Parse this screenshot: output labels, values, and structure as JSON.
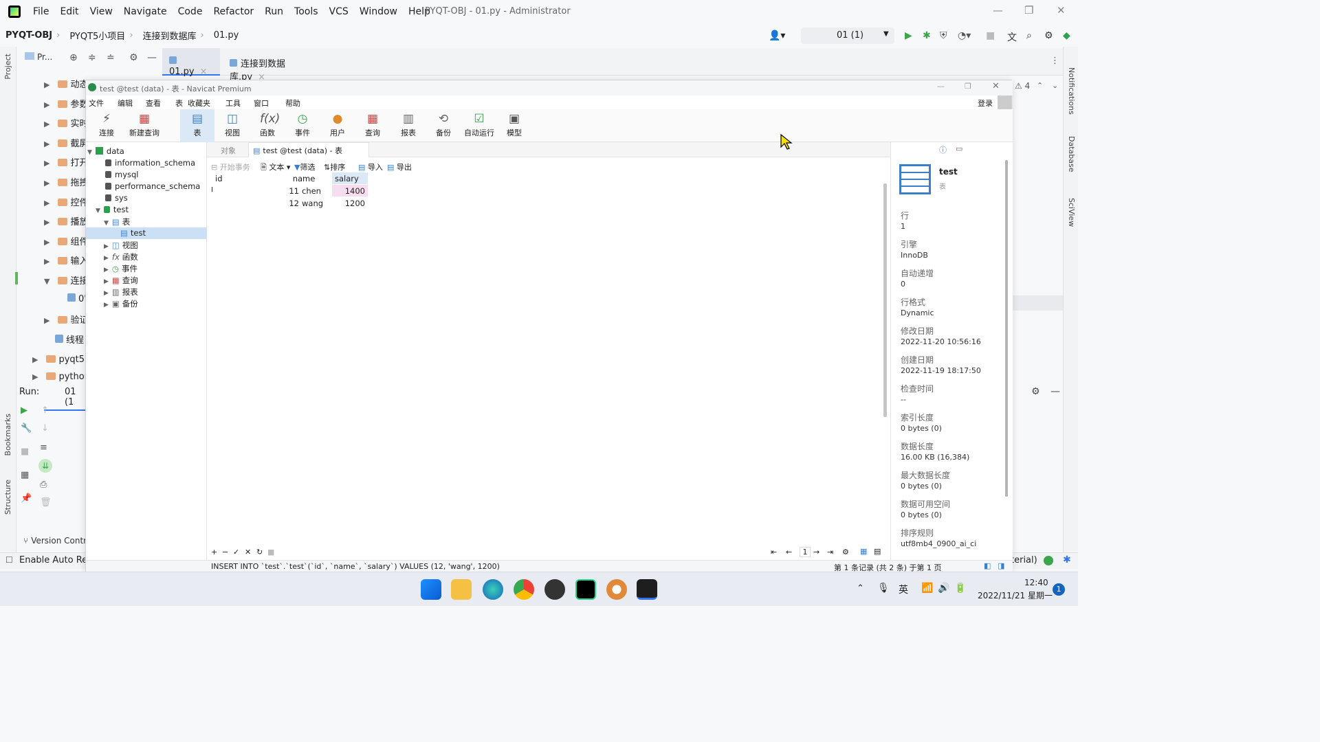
{
  "ide": {
    "menu": [
      "File",
      "Edit",
      "View",
      "Navigate",
      "Code",
      "Refactor",
      "Run",
      "Tools",
      "VCS",
      "Window",
      "Help"
    ],
    "window_title": "PYQT-OBJ - 01.py - Administrator",
    "breadcrumbs": [
      "PYQT-OBJ",
      "PYQT5小项目",
      "连接到数据库",
      "01.py"
    ],
    "run_config": "01 (1)",
    "project_label": "Pr...",
    "tabs": [
      {
        "label": "01.py"
      },
      {
        "label": "连接到数据库.py"
      }
    ],
    "warnings": "4",
    "project_items": [
      "动态",
      "参数(",
      "实时.",
      "截屏",
      "打开(",
      "拖拽!",
      "控件(",
      "播放.",
      "组件(",
      "输入(",
      "连接:",
      "0'",
      "验证(",
      "线程",
      "pyqt5的",
      "python"
    ],
    "run_label": "Run:",
    "run_tab": "01 (1",
    "side_labels": {
      "project": "Project",
      "bookmarks": "Bookmarks",
      "structure": "Structure",
      "notifications": "Notifications",
      "database": "Database",
      "sciview": "SciView"
    },
    "version_control": "Version Contro",
    "auto_rescan": "Enable Auto Res",
    "status_right": "terial)"
  },
  "navicat": {
    "title": "test @test (data) - 表 - Navicat Premium",
    "menu": [
      "文件",
      "编辑",
      "查看",
      "表",
      "收藏夹",
      "工具",
      "窗口",
      "帮助"
    ],
    "login": "登录",
    "toolbar": [
      "连接",
      "新建查询",
      "表",
      "视图",
      "函数",
      "事件",
      "用户",
      "查询",
      "报表",
      "备份",
      "自动运行",
      "模型"
    ],
    "tree": {
      "root": "data",
      "dbs": [
        "information_schema",
        "mysql",
        "performance_schema",
        "sys",
        "test"
      ],
      "group": "表",
      "table": "test",
      "others": [
        "视图",
        "函数",
        "事件",
        "查询",
        "报表",
        "备份"
      ]
    },
    "tabs": [
      "对象",
      "test @test (data) - 表"
    ],
    "subbar": [
      "开始事务",
      "文本",
      "筛选",
      "排序",
      "导入",
      "导出"
    ],
    "columns": [
      "id",
      "name",
      "salary"
    ],
    "rows": [
      {
        "id": "11",
        "name": "chen",
        "salary": "1400"
      },
      {
        "id": "12",
        "name": "wang",
        "salary": "1200"
      }
    ],
    "cursor_mark": "I",
    "page_number": "1",
    "sql": "INSERT INTO `test`.`test`(`id`, `name`, `salary`) VALUES (12, 'wang', 1200)",
    "record_status": "第 1 条记录 (共 2 条) 于第 1 页",
    "info": {
      "name": "test",
      "type": "表",
      "fields": [
        {
          "label": "行",
          "value": "1"
        },
        {
          "label": "引擎",
          "value": "InnoDB"
        },
        {
          "label": "自动递增",
          "value": "0"
        },
        {
          "label": "行格式",
          "value": "Dynamic"
        },
        {
          "label": "修改日期",
          "value": "2022-11-20 10:56:16"
        },
        {
          "label": "创建日期",
          "value": "2022-11-19 18:17:50"
        },
        {
          "label": "检查时间",
          "value": "--"
        },
        {
          "label": "索引长度",
          "value": "0 bytes (0)"
        },
        {
          "label": "数据长度",
          "value": "16.00 KB (16,384)"
        },
        {
          "label": "最大数据长度",
          "value": "0 bytes (0)"
        },
        {
          "label": "数据可用空间",
          "value": "0 bytes (0)"
        },
        {
          "label": "排序规则",
          "value": "utf8mb4_0900_ai_ci"
        }
      ]
    }
  },
  "taskbar": {
    "ime": "英",
    "time": "12:40",
    "date": "2022/11/21 星期一",
    "notif_count": "1"
  }
}
